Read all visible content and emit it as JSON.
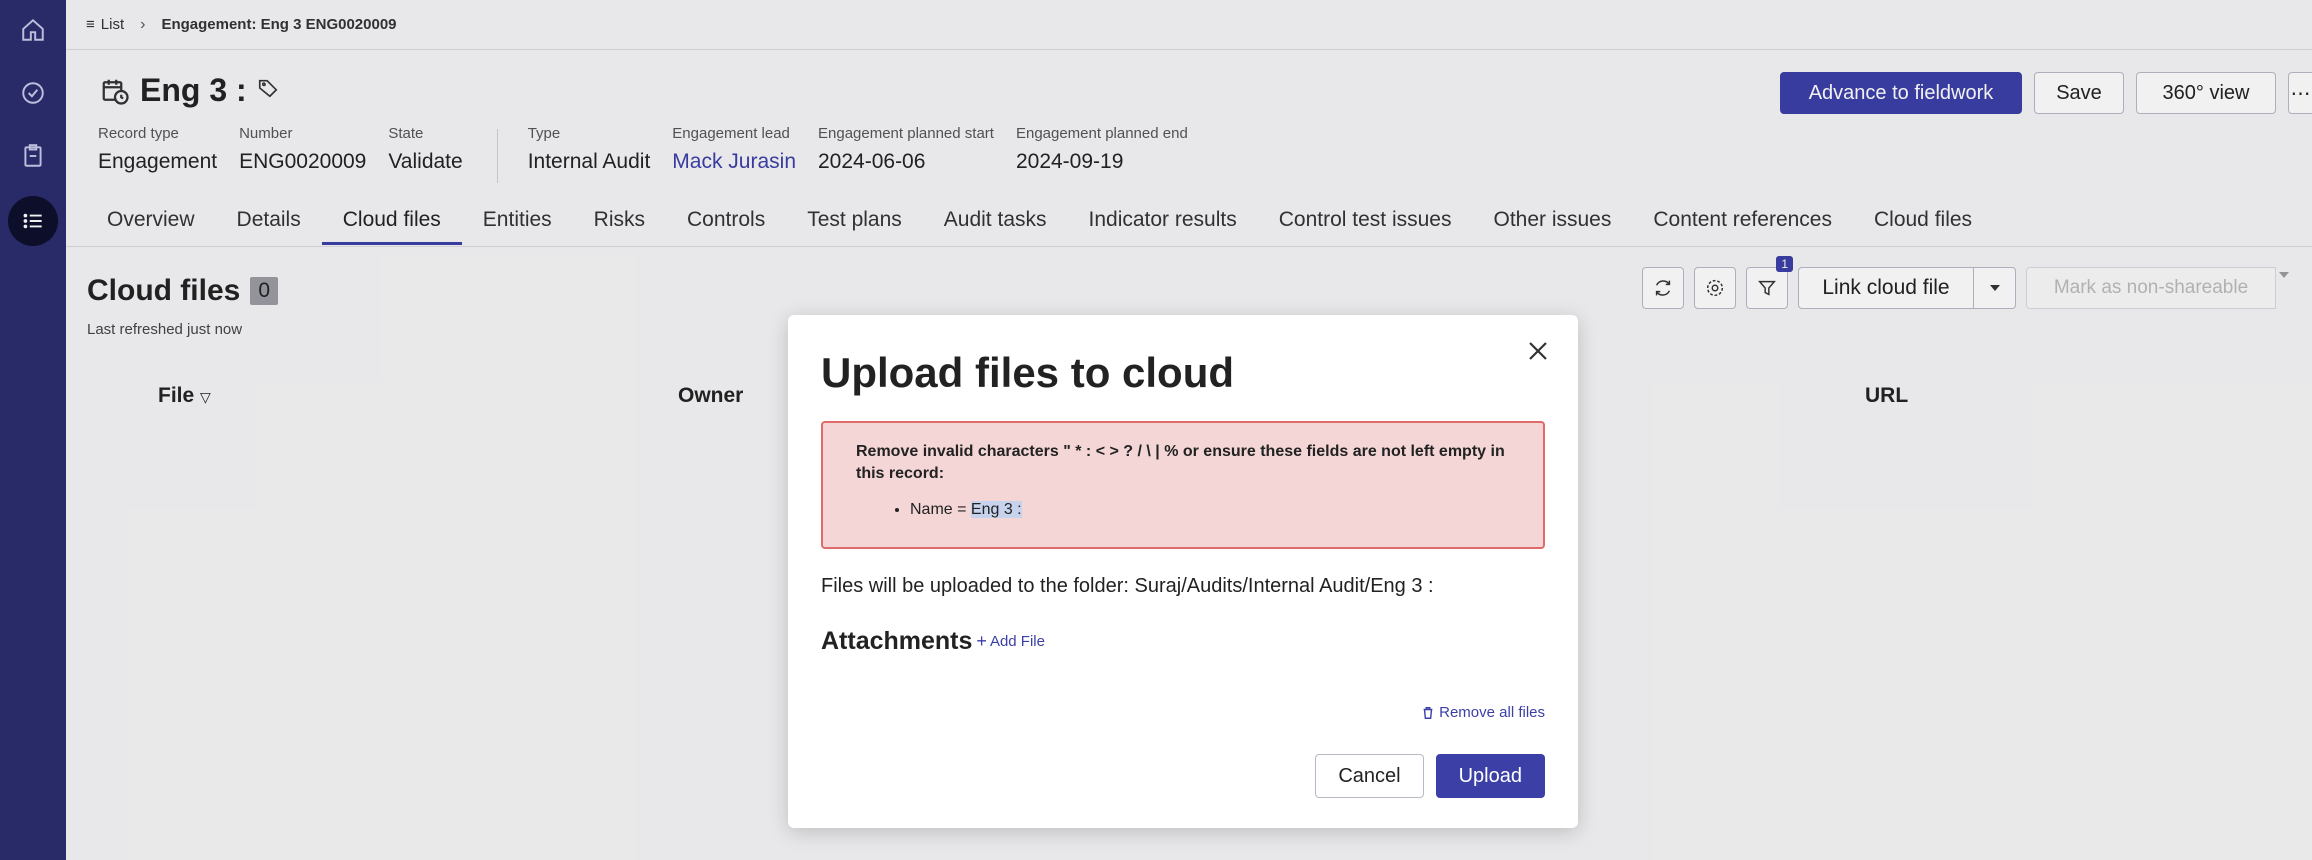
{
  "breadcrumb": {
    "list_label": "List",
    "current": "Engagement: Eng 3 ENG0020009"
  },
  "record": {
    "title": "Eng 3 :",
    "fields": [
      {
        "label": "Record type",
        "value": "Engagement"
      },
      {
        "label": "Number",
        "value": "ENG0020009"
      },
      {
        "label": "State",
        "value": "Validate"
      },
      {
        "label": "Type",
        "value": "Internal Audit"
      },
      {
        "label": "Engagement lead",
        "value": "Mack Jurasin"
      },
      {
        "label": "Engagement planned start",
        "value": "2024-06-06"
      },
      {
        "label": "Engagement planned end",
        "value": "2024-09-19"
      }
    ]
  },
  "actions": {
    "advance": "Advance to fieldwork",
    "save": "Save",
    "view360": "360° view"
  },
  "tabs": [
    "Overview",
    "Details",
    "Cloud files",
    "Entities",
    "Risks",
    "Controls",
    "Test plans",
    "Audit tasks",
    "Indicator results",
    "Control test issues",
    "Other issues",
    "Content references",
    "Cloud files"
  ],
  "cloud_files": {
    "title": "Cloud files",
    "count": "0",
    "refreshed": "Last refreshed just now",
    "filter_count": "1",
    "link_button": "Link cloud file",
    "disabled_button": "Mark as non-shareable",
    "columns": {
      "file": "File",
      "owner": "Owner",
      "url": "URL"
    }
  },
  "modal": {
    "title": "Upload files to cloud",
    "error_message": "Remove invalid characters \" * : < > ? / \\ | % or ensure these fields are not left empty in this record:",
    "error_item_prefix": "Name = ",
    "error_item_value": "Eng 3 :",
    "folder_text": "Files will be uploaded to the folder: Suraj/Audits/Internal Audit/Eng 3 :",
    "attachments_label": "Attachments",
    "add_file": "Add File",
    "remove_all": "Remove all files",
    "cancel": "Cancel",
    "upload": "Upload"
  },
  "colors": {
    "rail": "#2b2d6e",
    "primary": "#3b3fa6",
    "error_bg": "#f4d6d6",
    "error_border": "#e06b6b"
  },
  "icons": [
    "home-icon",
    "check-circle-icon",
    "clipboard-icon",
    "list-icon",
    "calendar-clock-icon",
    "tag-icon",
    "refresh-icon",
    "gear-icon",
    "filter-icon",
    "caret-down-icon",
    "close-icon",
    "trash-icon"
  ]
}
